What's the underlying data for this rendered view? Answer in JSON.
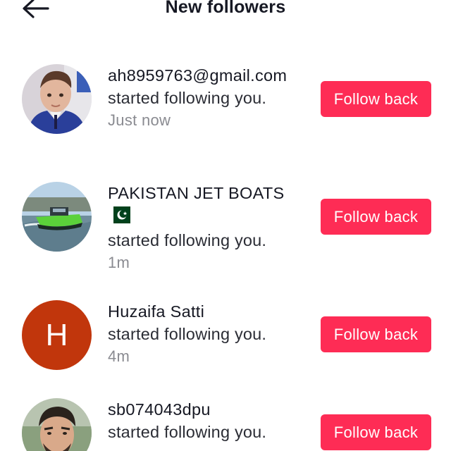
{
  "header": {
    "title": "New followers",
    "back_icon": "arrow-left-icon"
  },
  "followers": [
    {
      "name": "ah8959763@gmail.com",
      "message": "started following you.",
      "time": "Just now",
      "button": "Follow back",
      "avatar": "photo-child"
    },
    {
      "name": "PAKISTAN JET BOATS",
      "name_emoji": "pakistan-flag-icon",
      "message": "started following you.",
      "time": "1m",
      "button": "Follow back",
      "avatar": "photo-boat"
    },
    {
      "name": "Huzaifa Satti",
      "message": "started following you.",
      "time": "4m",
      "button": "Follow back",
      "avatar_letter": "H",
      "avatar_color": "#c1360c"
    },
    {
      "name": "sb074043dpu",
      "message": "started following you.",
      "button": "Follow back",
      "avatar": "photo-man"
    }
  ],
  "colors": {
    "accent": "#fe2c55",
    "text_primary": "#161823",
    "text_secondary": "#8a8b91"
  }
}
